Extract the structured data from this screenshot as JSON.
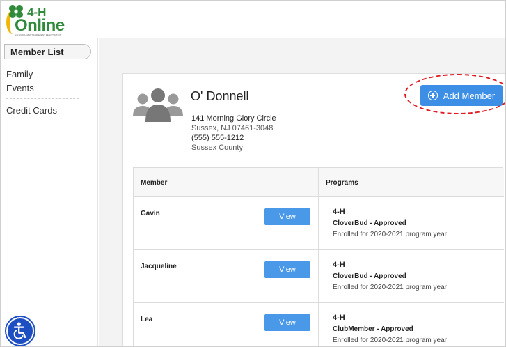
{
  "logo": {
    "brand_top": "4-H",
    "brand_main": "Online",
    "tagline": "4-H ENROLLMENT AND EVENT REGISTRATION"
  },
  "sidebar": {
    "items": [
      {
        "label": "Member List",
        "active": true
      },
      {
        "label": "Family",
        "active": false
      },
      {
        "label": "Events",
        "active": false
      },
      {
        "label": "Credit Cards",
        "active": false
      }
    ]
  },
  "family": {
    "name": "O' Donnell",
    "street": "141 Morning Glory Circle",
    "city": "Sussex, NJ 07461-3048",
    "phone": "(555) 555-1212",
    "county": "Sussex County"
  },
  "actions": {
    "add_member_label": "Add Member"
  },
  "table": {
    "headers": {
      "member": "Member",
      "programs": "Programs"
    },
    "view_label": "View",
    "rows": [
      {
        "name": "Gavin",
        "program": "4-H",
        "status": "CloverBud - Approved",
        "year": "Enrolled for 2020-2021 program year"
      },
      {
        "name": "Jacqueline",
        "program": "4-H",
        "status": "CloverBud - Approved",
        "year": "Enrolled for 2020-2021 program year"
      },
      {
        "name": "Lea",
        "program": "4-H",
        "status": "ClubMember - Approved",
        "year": "Enrolled for 2020-2021 program year"
      }
    ]
  },
  "colors": {
    "brand_green": "#2f8a3b",
    "accent_blue": "#3d8fe6",
    "highlight_red": "#e01b24",
    "arc_yellow": "#f2b705"
  },
  "icons": {
    "clover": "clover-icon",
    "family": "family-icon",
    "plus": "plus-circle-icon",
    "accessibility": "accessibility-icon"
  }
}
